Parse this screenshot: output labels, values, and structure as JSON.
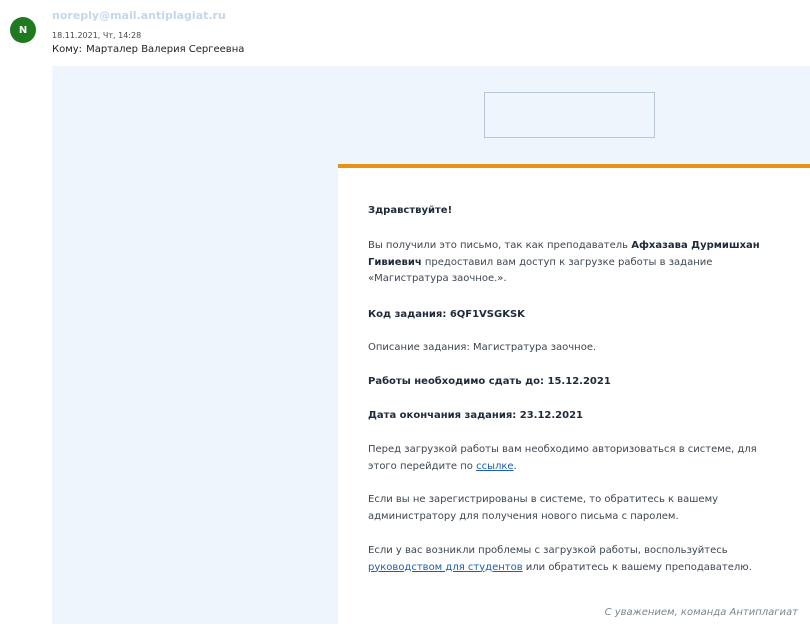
{
  "header": {
    "avatar_letter": "N",
    "sender": "noreply@mail.antiplagiat.ru",
    "date": "18.11.2021, Чт, 14:28",
    "to_label": "Кому:",
    "to_name": "Марталер Валерия Сергеевна"
  },
  "email": {
    "greeting": "Здравствуйте!",
    "intro_pre": "Вы получили это письмо, так как преподаватель ",
    "teacher_name": "Афхазава Дурмишхан Гивиевич",
    "intro_post": " предоставил вам доступ к загрузке работы в задание «Магистратура заочное.».",
    "code_label": "Код задания: ",
    "code_value": "6QF1VSGKSK",
    "description": "Описание задания: Магистратура заочное.",
    "due_label": "Работы необходимо сдать до: ",
    "due_value": "15.12.2021",
    "end_label": "Дата окончания задания: ",
    "end_value": "23.12.2021",
    "auth_pre": "Перед загрузкой работы вам необходимо авторизоваться в системе, для этого перейдите по ",
    "auth_link": "ссылке",
    "auth_post": ".",
    "not_registered": "Если вы не зарегистрированы в системе, то обратитесь к вашему администратору для получения нового письма с паролем.",
    "problems_pre": "Если у вас возникли проблемы с загрузкой работы, воспользуйтесь ",
    "problems_link": "руководством для студентов",
    "problems_post": " или обратитесь к вашему преподавателю.",
    "signature": "С уважением, команда Антиплагиат"
  }
}
